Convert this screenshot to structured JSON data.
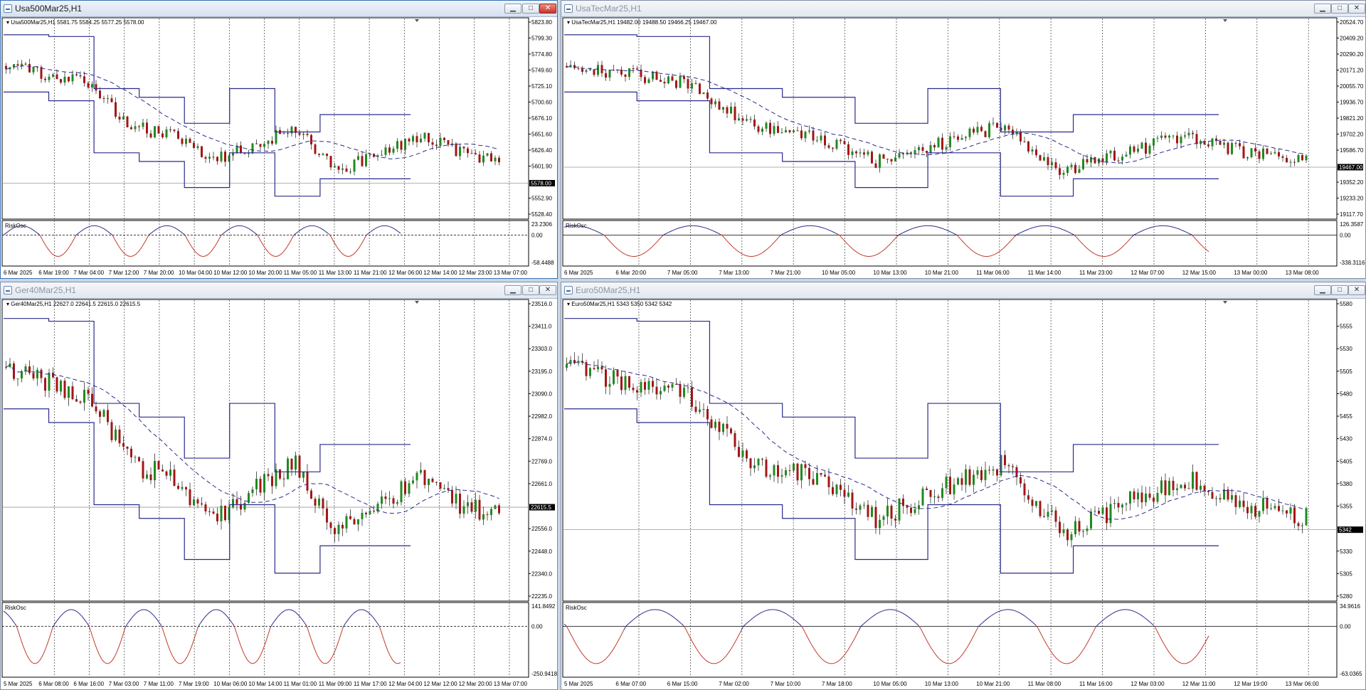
{
  "windows": [
    {
      "id": "usa500",
      "title": "Usa500Mar25,H1",
      "active": true,
      "header_text": "Usa500Mar25,H1  5581.75 5584.25 5577.25 5578.00",
      "price_labels": [
        "5823.80",
        "5799.30",
        "5774.80",
        "5749.60",
        "5725.10",
        "5700.60",
        "5676.10",
        "5651.60",
        "5626.40",
        "5601.90",
        "5578.00",
        "5552.90",
        "5528.40"
      ],
      "current_price": "5578.00",
      "osc_name": "RiskOsc",
      "osc_labels": [
        "23.2306",
        "0.00",
        "-58.4488"
      ],
      "time_labels": [
        "6 Mar 2025",
        "6 Mar 19:00",
        "7 Mar 04:00",
        "7 Mar 12:00",
        "7 Mar 20:00",
        "10 Mar 04:00",
        "10 Mar 12:00",
        "10 Mar 20:00",
        "11 Mar 05:00",
        "11 Mar 13:00",
        "11 Mar 21:00",
        "12 Mar 06:00",
        "12 Mar 14:00",
        "12 Mar 23:00",
        "13 Mar 07:00"
      ]
    },
    {
      "id": "usatec",
      "title": "UsaTecMar25,H1",
      "active": false,
      "header_text": "UsaTecMar25,H1  19482.00 19488.50 19466.25 19467.00",
      "price_labels": [
        "20524.70",
        "20409.20",
        "20290.20",
        "20171.20",
        "20055.70",
        "19936.70",
        "19821.20",
        "19702.20",
        "19586.70",
        "19467.00",
        "19352.20",
        "19233.20",
        "19117.70"
      ],
      "current_price": "19467.00",
      "osc_name": "RiskOsc",
      "osc_labels": [
        "126.3587",
        "0.00",
        "-338.3116"
      ],
      "time_labels": [
        "6 Mar 2025",
        "6 Mar 20:00",
        "7 Mar 05:00",
        "7 Mar 13:00",
        "7 Mar 21:00",
        "10 Mar 05:00",
        "10 Mar 13:00",
        "10 Mar 21:00",
        "11 Mar 06:00",
        "11 Mar 14:00",
        "11 Mar 23:00",
        "12 Mar 07:00",
        "12 Mar 15:00",
        "13 Mar 00:00",
        "13 Mar 08:00"
      ]
    },
    {
      "id": "ger40",
      "title": "Ger40Mar25,H1",
      "active": false,
      "header_text": "Ger40Mar25,H1  22627.0 22641.5 22615.0 22615.5",
      "price_labels": [
        "23516.0",
        "23411.0",
        "23303.0",
        "23195.0",
        "23090.0",
        "22982.0",
        "22874.0",
        "22769.0",
        "22661.0",
        "22615.5",
        "22556.0",
        "22448.0",
        "22340.0",
        "22235.0"
      ],
      "current_price": "22615.5",
      "osc_name": "RiskOsc",
      "osc_labels": [
        "141.8492",
        "0.00",
        "-250.9418"
      ],
      "time_labels": [
        "5 Mar 2025",
        "6 Mar 08:00",
        "6 Mar 16:00",
        "7 Mar 03:00",
        "7 Mar 11:00",
        "7 Mar 19:00",
        "10 Mar 06:00",
        "10 Mar 14:00",
        "11 Mar 01:00",
        "11 Mar 09:00",
        "11 Mar 17:00",
        "12 Mar 04:00",
        "12 Mar 12:00",
        "12 Mar 20:00",
        "13 Mar 07:00"
      ]
    },
    {
      "id": "euro50",
      "title": "Euro50Mar25,H1",
      "active": false,
      "header_text": "Euro50Mar25,H1  5343 5350 5342 5342",
      "price_labels": [
        "5580",
        "5555",
        "5530",
        "5505",
        "5480",
        "5455",
        "5430",
        "5405",
        "5380",
        "5355",
        "5342",
        "5330",
        "5305",
        "5280"
      ],
      "current_price": "5342",
      "osc_name": "RiskOsc",
      "osc_labels": [
        "34.9616",
        "0.00",
        "-63.0365"
      ],
      "time_labels": [
        "5 Mar 2025",
        "6 Mar 07:00",
        "6 Mar 15:00",
        "7 Mar 02:00",
        "7 Mar 10:00",
        "7 Mar 18:00",
        "10 Mar 05:00",
        "10 Mar 13:00",
        "10 Mar 21:00",
        "11 Mar 08:00",
        "11 Mar 16:00",
        "12 Mar 03:00",
        "12 Mar 11:00",
        "12 Mar 19:00",
        "13 Mar 06:00"
      ]
    }
  ],
  "colors": {
    "bull": "#1f8a1f",
    "bear": "#a31515",
    "channel": "#2b2b8c",
    "ma": "#2b2b8c",
    "osc_up": "#2b2b8c",
    "osc_down": "#c0392b",
    "price_box": "#000000"
  },
  "window_buttons": {
    "minimize": "▁",
    "maximize": "□",
    "close": "✕"
  }
}
